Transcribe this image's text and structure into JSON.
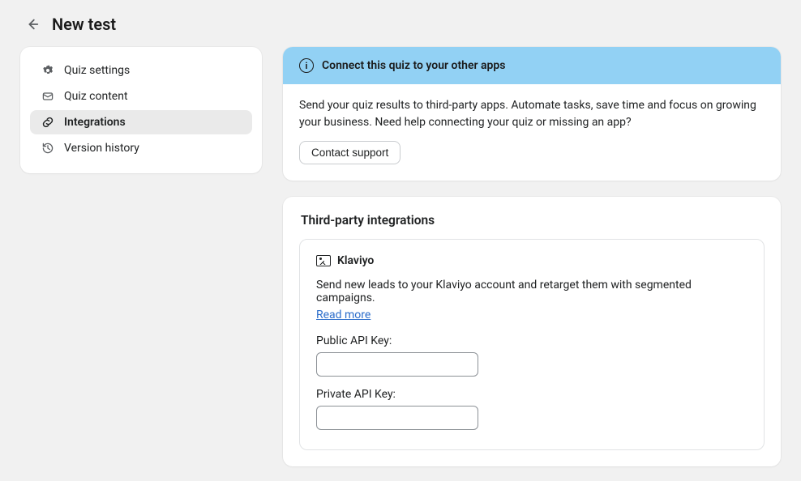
{
  "header": {
    "title": "New test"
  },
  "sidebar": {
    "items": [
      {
        "label": "Quiz settings"
      },
      {
        "label": "Quiz content"
      },
      {
        "label": "Integrations"
      },
      {
        "label": "Version history"
      }
    ]
  },
  "banner": {
    "title": "Connect this quiz to your other apps",
    "description": "Send your quiz results to third-party apps. Automate tasks, save time and focus on growing your business. Need help connecting your quiz or missing an app?",
    "button": "Contact support"
  },
  "integrations": {
    "sectionTitle": "Third-party integrations",
    "klaviyo": {
      "name": "Klaviyo",
      "description": "Send new leads to your Klaviyo account and retarget them with segmented campaigns.",
      "readMore": "Read more",
      "publicKeyLabel": "Public API Key:",
      "publicKeyValue": "",
      "privateKeyLabel": "Private API Key:",
      "privateKeyValue": ""
    }
  }
}
